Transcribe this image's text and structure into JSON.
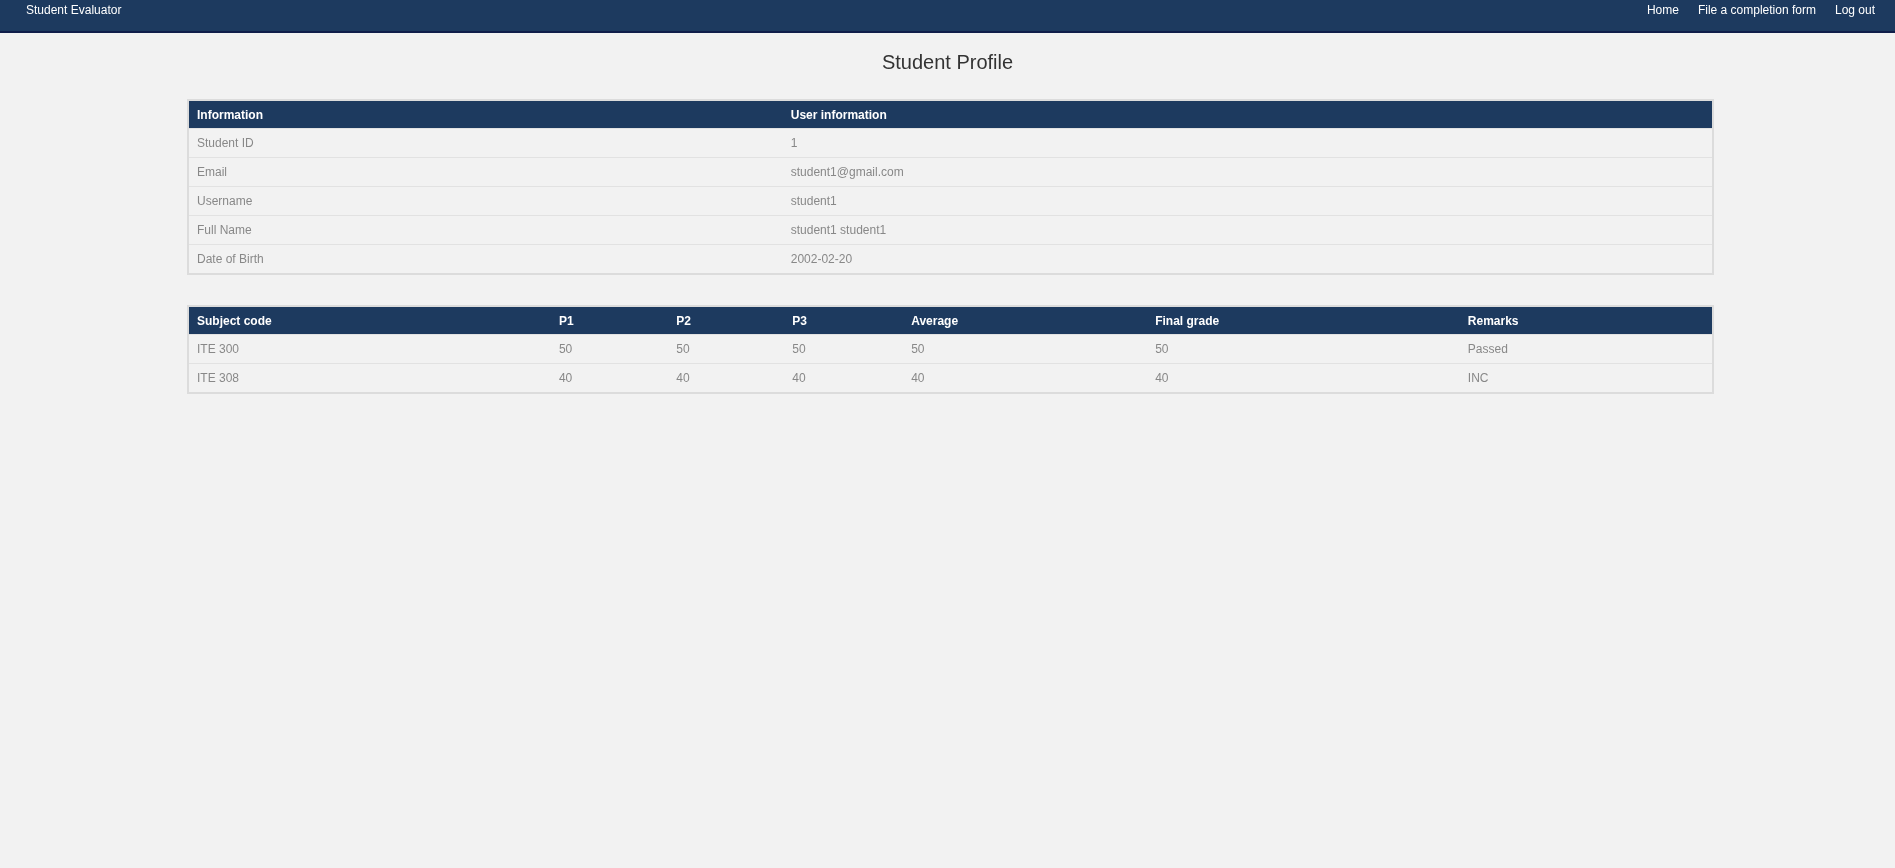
{
  "navbar": {
    "brand": "Student Evaluator",
    "links": [
      "Home",
      "File a completion form",
      "Log out"
    ]
  },
  "page_title": "Student Profile",
  "info_table": {
    "columns": [
      "Information",
      "User information"
    ],
    "rows": [
      [
        "Student ID",
        "1"
      ],
      [
        "Email",
        "student1@gmail.com"
      ],
      [
        "Username",
        "student1"
      ],
      [
        "Full Name",
        "student1 student1"
      ],
      [
        "Date of Birth",
        "2002-02-20"
      ]
    ]
  },
  "grades_table": {
    "columns": [
      "Subject code",
      "P1",
      "P2",
      "P3",
      "Average",
      "Final grade",
      "Remarks"
    ],
    "rows": [
      [
        "ITE 300",
        "50",
        "50",
        "50",
        "50",
        "50",
        "Passed"
      ],
      [
        "ITE 308",
        "40",
        "40",
        "40",
        "40",
        "40",
        "INC"
      ]
    ]
  }
}
